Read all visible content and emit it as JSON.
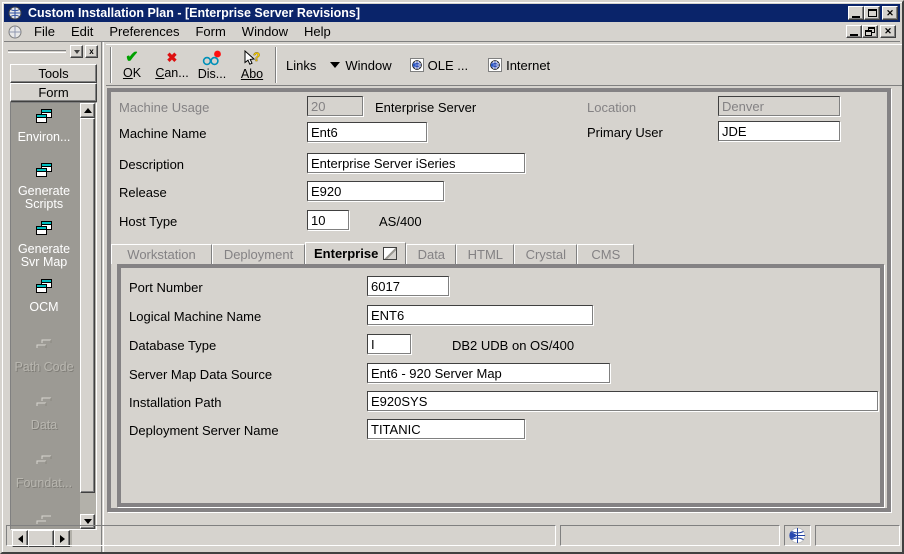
{
  "window": {
    "title": "Custom Installation Plan - [Enterprise Server Revisions]"
  },
  "menu": {
    "items": [
      "File",
      "Edit",
      "Preferences",
      "Form",
      "Window",
      "Help"
    ]
  },
  "toolbar": {
    "ok": "OK",
    "cancel": "Can...",
    "display": "Dis...",
    "about": "Abo",
    "links": "Links",
    "window": "Window",
    "ole": "OLE ...",
    "internet": "Internet"
  },
  "sidebar": {
    "tools": "Tools",
    "form": "Form",
    "items": [
      {
        "label": "Environ...",
        "enabled": true
      },
      {
        "label": "Generate Scripts",
        "enabled": true
      },
      {
        "label": "Generate Svr Map",
        "enabled": true
      },
      {
        "label": "OCM",
        "enabled": true
      },
      {
        "label": "Path Code",
        "enabled": false
      },
      {
        "label": "Data",
        "enabled": false
      },
      {
        "label": "Foundat...",
        "enabled": false
      }
    ]
  },
  "form": {
    "machine_usage": {
      "label": "Machine Usage",
      "value": "20",
      "note": "Enterprise Server"
    },
    "location": {
      "label": "Location",
      "value": "Denver"
    },
    "machine_name": {
      "label": "Machine Name",
      "value": "Ent6"
    },
    "primary_user": {
      "label": "Primary User",
      "value": "JDE"
    },
    "description": {
      "label": "Description",
      "value": "Enterprise Server iSeries"
    },
    "release": {
      "label": "Release",
      "value": "E920"
    },
    "host_type": {
      "label": "Host Type",
      "value": "10",
      "note": "AS/400"
    }
  },
  "tabs": {
    "items": [
      "Workstation",
      "Deployment",
      "Enterprise",
      "Data",
      "HTML",
      "Crystal",
      "CMS"
    ],
    "active": "Enterprise"
  },
  "enterprise_tab": {
    "port_number": {
      "label": "Port Number",
      "value": "6017"
    },
    "logical_machine_name": {
      "label": "Logical Machine Name",
      "value": "ENT6"
    },
    "database_type": {
      "label": "Database Type",
      "value": "I",
      "note": "DB2 UDB on OS/400"
    },
    "server_map_data_source": {
      "label": "Server Map Data Source",
      "value": "Ent6 - 920 Server Map"
    },
    "installation_path": {
      "label": "Installation Path",
      "value": "E920SYS"
    },
    "deployment_server_name": {
      "label": "Deployment Server Name",
      "value": "TITANIC"
    }
  },
  "colors": {
    "titlebar": "#0a246a",
    "face": "#d6d3ce",
    "exit_panel": "#9c9a94",
    "ok_green": "#00a000",
    "cancel_red": "#dd1010"
  }
}
